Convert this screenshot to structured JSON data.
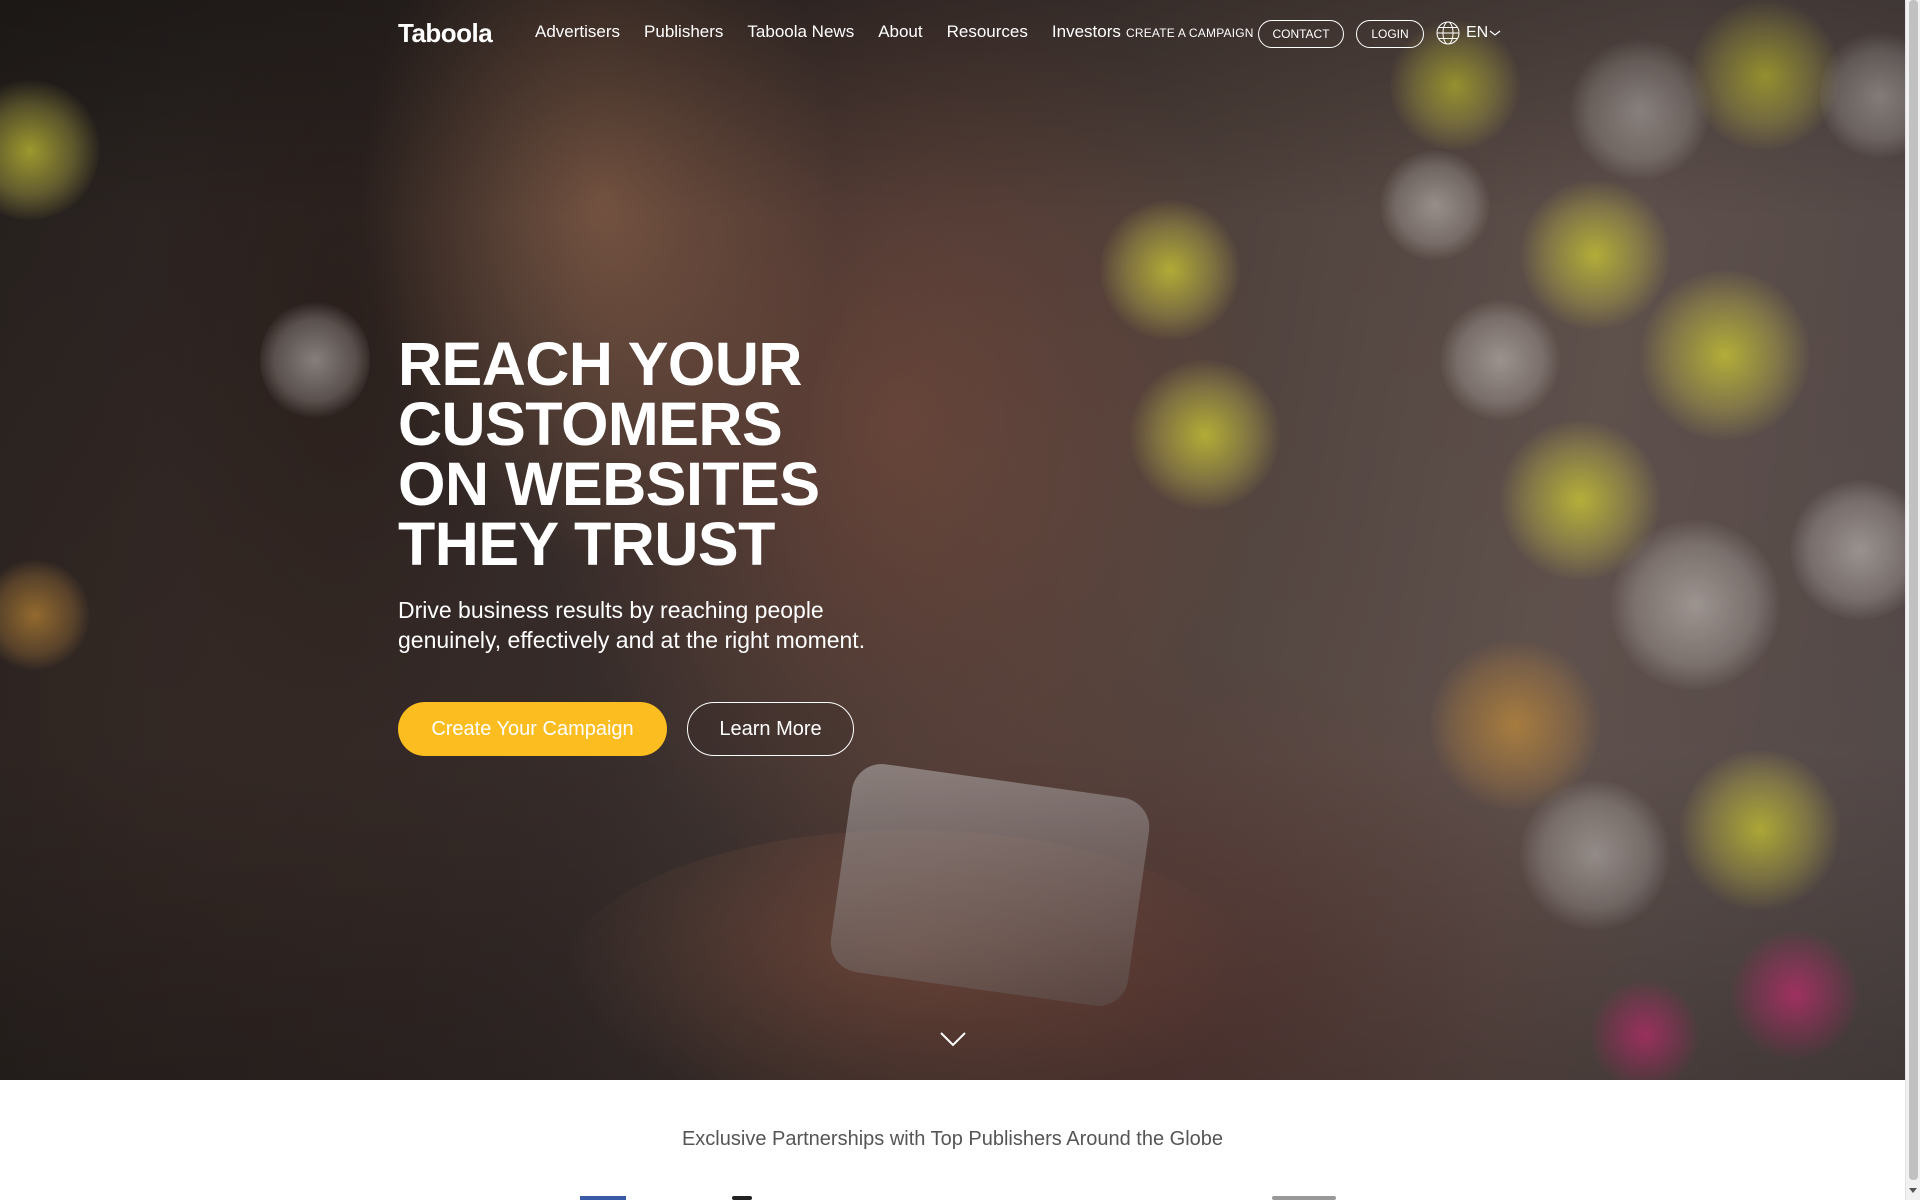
{
  "brand": {
    "logo_text": "Taboola"
  },
  "nav": {
    "links": [
      {
        "label": "Advertisers"
      },
      {
        "label": "Publishers"
      },
      {
        "label": "Taboola News"
      },
      {
        "label": "About"
      },
      {
        "label": "Resources"
      },
      {
        "label": "Investors"
      }
    ],
    "create_campaign": "CREATE A CAMPAIGN",
    "contact": "CONTACT",
    "login": "LOGIN",
    "language": "EN",
    "language_icon": "globe-icon",
    "language_caret_icon": "chevron-down-icon"
  },
  "hero": {
    "title_lines": [
      "REACH YOUR",
      "CUSTOMERS",
      "ON WEBSITES",
      "THEY TRUST"
    ],
    "subtitle": "Drive business results by reaching people genuinely, effectively and at the right moment.",
    "primary_button": "Create Your Campaign",
    "secondary_button": "Learn More",
    "scroll_icon": "chevron-down-icon"
  },
  "partners": {
    "title": "Exclusive Partnerships with Top Publishers Around the Globe"
  },
  "colors": {
    "accent": "#fbbd20",
    "text_on_hero": "#ffffff",
    "partners_text": "#555555"
  }
}
